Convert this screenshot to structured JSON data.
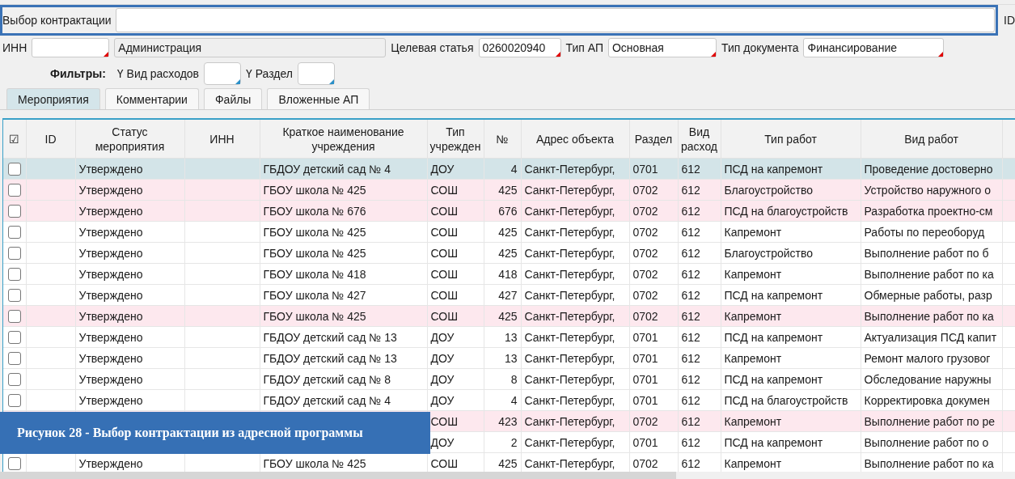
{
  "contract_choice": {
    "label": "Выбор контрактации",
    "side_label": "ID"
  },
  "fields": [
    {
      "label": "ИНН",
      "required": true,
      "readonly": false
    },
    {
      "value": "Администрация",
      "required": false,
      "readonly": true
    },
    {
      "label": "Целевая статья",
      "value": "0260020940",
      "required": true,
      "readonly": false
    },
    {
      "label": "Тип АП",
      "value": "Основная",
      "required": true,
      "readonly": false
    },
    {
      "label": "Тип документа",
      "value": "Финансирование",
      "required": true,
      "readonly": false
    }
  ],
  "filters": {
    "title": "Фильтры:",
    "items": [
      {
        "icon": "Ү",
        "label": "Вид расходов"
      },
      {
        "icon": "Ү",
        "label": "Раздел"
      }
    ]
  },
  "tabs": [
    {
      "label": "Мероприятия",
      "selected": true
    },
    {
      "label": "Комментарии",
      "selected": false
    },
    {
      "label": "Файлы",
      "selected": false
    },
    {
      "label": "Вложенные АП",
      "selected": false
    }
  ],
  "table": {
    "columns": [
      "☑",
      "ID",
      "Статус мероприятия",
      "ИНН",
      "Краткое наименование учреждения",
      "Тип учрежден",
      "№",
      "Адрес объекта",
      "Раздел",
      "Вид расход",
      "Тип работ",
      "Вид работ"
    ],
    "rows": [
      {
        "selected": true,
        "highlighted": false,
        "checked": false,
        "status": "Утверждено",
        "name": "ГБДОУ детский сад № 4",
        "type": "ДОУ",
        "number": "4",
        "address": "Санкт-Петербург,",
        "section": "0701",
        "expense": "612",
        "work_type": "ПСД на капремонт",
        "work": "Проведение достоверно"
      },
      {
        "selected": false,
        "highlighted": true,
        "checked": false,
        "status": "Утверждено",
        "name": "ГБОУ школа № 425",
        "type": "СОШ",
        "number": "425",
        "address": "Санкт-Петербург,",
        "section": "0702",
        "expense": "612",
        "work_type": "Благоустройство",
        "work": "Устройство наружного о"
      },
      {
        "selected": false,
        "highlighted": true,
        "checked": false,
        "status": "Утверждено",
        "name": "ГБОУ школа № 676",
        "type": "СОШ",
        "number": "676",
        "address": "Санкт-Петербург,",
        "section": "0702",
        "expense": "612",
        "work_type": "ПСД на благоустройств",
        "work": "Разработка проектно-см"
      },
      {
        "selected": false,
        "highlighted": false,
        "checked": false,
        "status": "Утверждено",
        "name": "ГБОУ школа № 425",
        "type": "СОШ",
        "number": "425",
        "address": "Санкт-Петербург,",
        "section": "0702",
        "expense": "612",
        "work_type": "Капремонт",
        "work": "Работы по переоборуд"
      },
      {
        "selected": false,
        "highlighted": false,
        "checked": false,
        "status": "Утверждено",
        "name": "ГБОУ школа № 425",
        "type": "СОШ",
        "number": "425",
        "address": "Санкт-Петербург,",
        "section": "0702",
        "expense": "612",
        "work_type": "Благоустройство",
        "work": "Выполнение работ по б"
      },
      {
        "selected": false,
        "highlighted": false,
        "checked": false,
        "status": "Утверждено",
        "name": "ГБОУ школа № 418",
        "type": "СОШ",
        "number": "418",
        "address": "Санкт-Петербург,",
        "section": "0702",
        "expense": "612",
        "work_type": "Капремонт",
        "work": "Выполнение работ по ка"
      },
      {
        "selected": false,
        "highlighted": false,
        "checked": false,
        "status": "Утверждено",
        "name": "ГБОУ школа № 427",
        "type": "СОШ",
        "number": "427",
        "address": "Санкт-Петербург,",
        "section": "0702",
        "expense": "612",
        "work_type": "ПСД на капремонт",
        "work": "Обмерные работы, разр"
      },
      {
        "selected": false,
        "highlighted": true,
        "checked": false,
        "status": "Утверждено",
        "name": "ГБОУ школа № 425",
        "type": "СОШ",
        "number": "425",
        "address": "Санкт-Петербург,",
        "section": "0702",
        "expense": "612",
        "work_type": "Капремонт",
        "work": "Выполнение работ по ка"
      },
      {
        "selected": false,
        "highlighted": false,
        "checked": false,
        "status": "Утверждено",
        "name": "ГБДОУ детский сад № 13",
        "type": "ДОУ",
        "number": "13",
        "address": "Санкт-Петербург,",
        "section": "0701",
        "expense": "612",
        "work_type": "ПСД на капремонт",
        "work": "Актуализация ПСД капит"
      },
      {
        "selected": false,
        "highlighted": false,
        "checked": false,
        "status": "Утверждено",
        "name": "ГБДОУ детский сад № 13",
        "type": "ДОУ",
        "number": "13",
        "address": "Санкт-Петербург,",
        "section": "0701",
        "expense": "612",
        "work_type": "Капремонт",
        "work": "Ремонт малого грузовог"
      },
      {
        "selected": false,
        "highlighted": false,
        "checked": false,
        "status": "Утверждено",
        "name": "ГБДОУ детский сад № 8",
        "type": "ДОУ",
        "number": "8",
        "address": "Санкт-Петербург,",
        "section": "0701",
        "expense": "612",
        "work_type": "ПСД на капремонт",
        "work": "Обследование наружны"
      },
      {
        "selected": false,
        "highlighted": false,
        "checked": false,
        "status": "Утверждено",
        "name": "ГБДОУ детский сад № 4",
        "type": "ДОУ",
        "number": "4",
        "address": "Санкт-Петербург,",
        "section": "0701",
        "expense": "612",
        "work_type": "ПСД на благоустройств",
        "work": "Корректировка докумен"
      },
      {
        "selected": false,
        "highlighted": true,
        "type": "СОШ",
        "number": "423",
        "address": "Санкт-Петербург,",
        "section": "0702",
        "expense": "612",
        "work_type": "Капремонт",
        "work": "Выполнение работ по ре"
      },
      {
        "selected": false,
        "highlighted": false,
        "type": "ДОУ",
        "number": "2",
        "address": "Санкт-Петербург,",
        "section": "0701",
        "expense": "612",
        "work_type": "ПСД на капремонт",
        "work": "Выполнение работ по о"
      },
      {
        "selected": false,
        "highlighted": false,
        "checked": false,
        "status": "Утверждено",
        "name": "ГБОУ школа № 425",
        "type": "СОШ",
        "number": "425",
        "address": "Санкт-Петербург,",
        "section": "0702",
        "expense": "612",
        "work_type": "Капремонт",
        "work": "Выполнение работ по ка"
      }
    ]
  },
  "caption": "Рисунок 28 - Выбор контрактации из адресной программы"
}
